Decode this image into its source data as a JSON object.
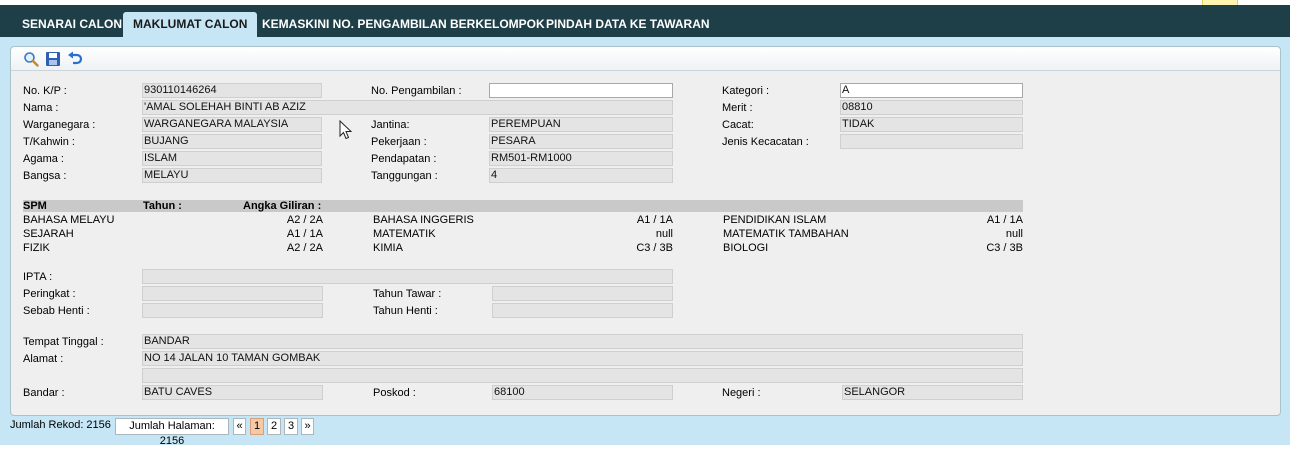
{
  "tabs": [
    "SENARAI CALON",
    "MAKLUMAT CALON",
    "KEMASKINI NO. PENGAMBILAN BERKELOMPOK",
    "PINDAH DATA KE TAWARAN"
  ],
  "toolbar": {
    "icons": [
      "search-icon",
      "save-icon",
      "undo-icon"
    ]
  },
  "form": {
    "nokp_label": "No. K/P :",
    "nokp": "930110146264",
    "nama_label": "Nama :",
    "nama": "'AMAL SOLEHAH BINTI AB AZIZ",
    "warganegara_label": "Warganegara :",
    "warganegara": "WARGANEGARA MALAYSIA",
    "tkahwin_label": "T/Kahwin :",
    "tkahwin": "BUJANG",
    "agama_label": "Agama :",
    "agama": "ISLAM",
    "bangsa_label": "Bangsa :",
    "bangsa": "MELAYU",
    "nopengambilan_label": "No. Pengambilan :",
    "nopengambilan": "",
    "jantina_label": "Jantina:",
    "jantina": "PEREMPUAN",
    "pekerjaan_label": "Pekerjaan :",
    "pekerjaan": "PESARA",
    "pendapatan_label": "Pendapatan :",
    "pendapatan": "RM501-RM1000",
    "tanggungan_label": "Tanggungan :",
    "tanggungan": "4",
    "kategori_label": "Kategori :",
    "kategori": "A",
    "merit_label": "Merit :",
    "merit": "08810",
    "cacat_label": "Cacat:",
    "cacat": "TIDAK",
    "jeniskecacatan_label": "Jenis Kecacatan :",
    "jeniskecacatan": ""
  },
  "spm": {
    "title": "SPM",
    "tahun_label": "Tahun :",
    "angka_label": "Angka Giliran :",
    "subjects": [
      {
        "name": "BAHASA MELAYU",
        "grade": "A2 / 2A"
      },
      {
        "name": "BAHASA INGGERIS",
        "grade": "A1 / 1A"
      },
      {
        "name": "PENDIDIKAN ISLAM",
        "grade": "A1 / 1A"
      },
      {
        "name": "SEJARAH",
        "grade": "A1 / 1A"
      },
      {
        "name": "MATEMATIK",
        "grade": "null"
      },
      {
        "name": "MATEMATIK TAMBAHAN",
        "grade": "null"
      },
      {
        "name": "FIZIK",
        "grade": "A2 / 2A"
      },
      {
        "name": "KIMIA",
        "grade": "C3 / 3B"
      },
      {
        "name": "BIOLOGI",
        "grade": "C3 / 3B"
      }
    ]
  },
  "ipta": {
    "ipta_label": "IPTA :",
    "ipta": "",
    "peringkat_label": "Peringkat :",
    "peringkat": "",
    "tahuntawar_label": "Tahun Tawar :",
    "tahuntawar": "",
    "sebabhenti_label": "Sebab Henti :",
    "sebabhenti": "",
    "tahunhenti_label": "Tahun Henti :",
    "tahunhenti": ""
  },
  "address": {
    "tempat_label": "Tempat Tinggal :",
    "tempat": "BANDAR",
    "alamat_label": "Alamat :",
    "alamat1": "NO 14 JALAN 10 TAMAN GOMBAK",
    "alamat2": "",
    "bandar_label": "Bandar :",
    "bandar": "BATU CAVES",
    "poskod_label": "Poskod :",
    "poskod": "68100",
    "negeri_label": "Negeri :",
    "negeri": "SELANGOR"
  },
  "footer": {
    "jumlah_rekod": "Jumlah Rekod: 2156",
    "jumlah_halaman": "Jumlah Halaman: 2156",
    "prev": "«",
    "pages": [
      "1",
      "2",
      "3"
    ],
    "next": "»"
  }
}
